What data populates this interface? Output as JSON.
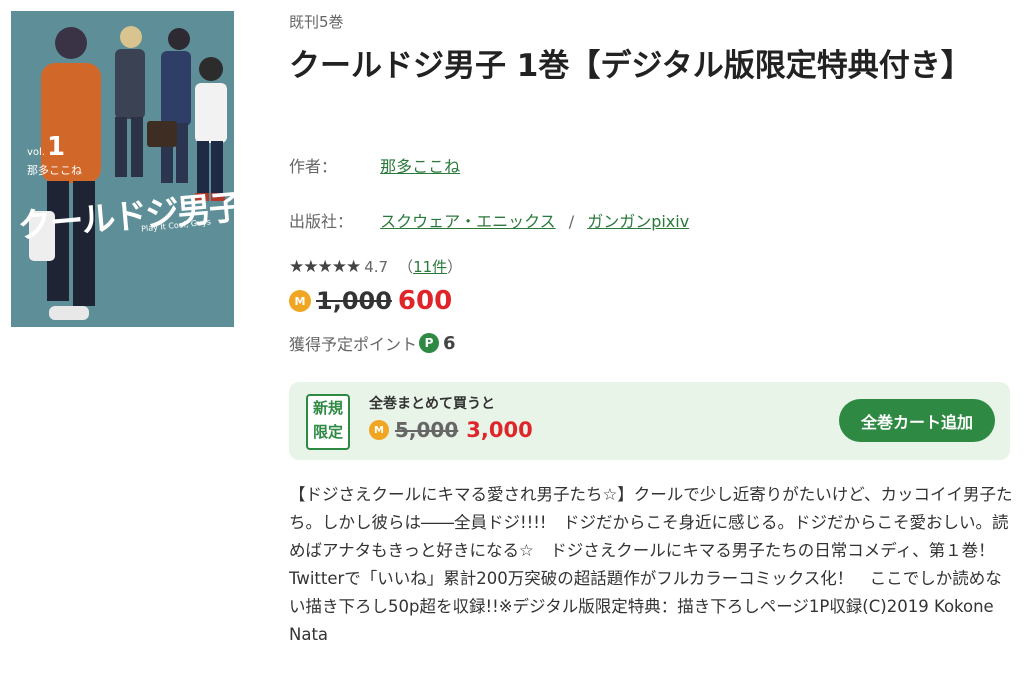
{
  "cover": {
    "vol_label": "vol.",
    "vol_number": "1",
    "author": "那多ここね",
    "title_art": "クールドジ男子",
    "subtitle": "Play It Cool, Guys"
  },
  "series_count": "既刊5巻",
  "title": "クールドジ男子 1巻【デジタル版限定特典付き】",
  "author_label": "作者：",
  "author_name": "那多ここね",
  "publisher_label": "出版社：",
  "publisher_name": "スクウェア・エニックス",
  "publisher_separator": "/",
  "label_name": "ガンガンpixiv",
  "rating": {
    "stars": "★★★★★",
    "score": "4.7",
    "count_open": "（",
    "count_link": "11件",
    "count_close": "）"
  },
  "price": {
    "coin": "M",
    "original": "1,000",
    "sale": "600"
  },
  "points": {
    "label": "獲得予定ポイント",
    "icon": "P",
    "value": "6"
  },
  "promo": {
    "badge_line1": "新規",
    "badge_line2": "限定",
    "lead": "全巻まとめて買うと",
    "coin": "M",
    "original": "5,000",
    "sale": "3,000",
    "button": "全巻カート追加",
    "color_bg": "#e9f4e9",
    "color_accent": "#2e8a43"
  },
  "description": "【ドジさえクールにキマる愛され男子たち☆】クールで少し近寄りがたいけど、カッコイイ男子たち。しかし彼らは――全員ドジ!!!!　ドジだからこそ身近に感じる。ドジだからこそ愛おしい。読めばアナタもきっと好きになる☆　ドジさえクールにキマる男子たちの日常コメディ、第１巻！　Twitterで「いいね」累計200万突破の超話題作がフルカラーコミックス化！　ここでしか読めない描き下ろし50p超を収録!!※デジタル版限定特典：描き下ろしページ1P収録(C)2019 Kokone Nata"
}
